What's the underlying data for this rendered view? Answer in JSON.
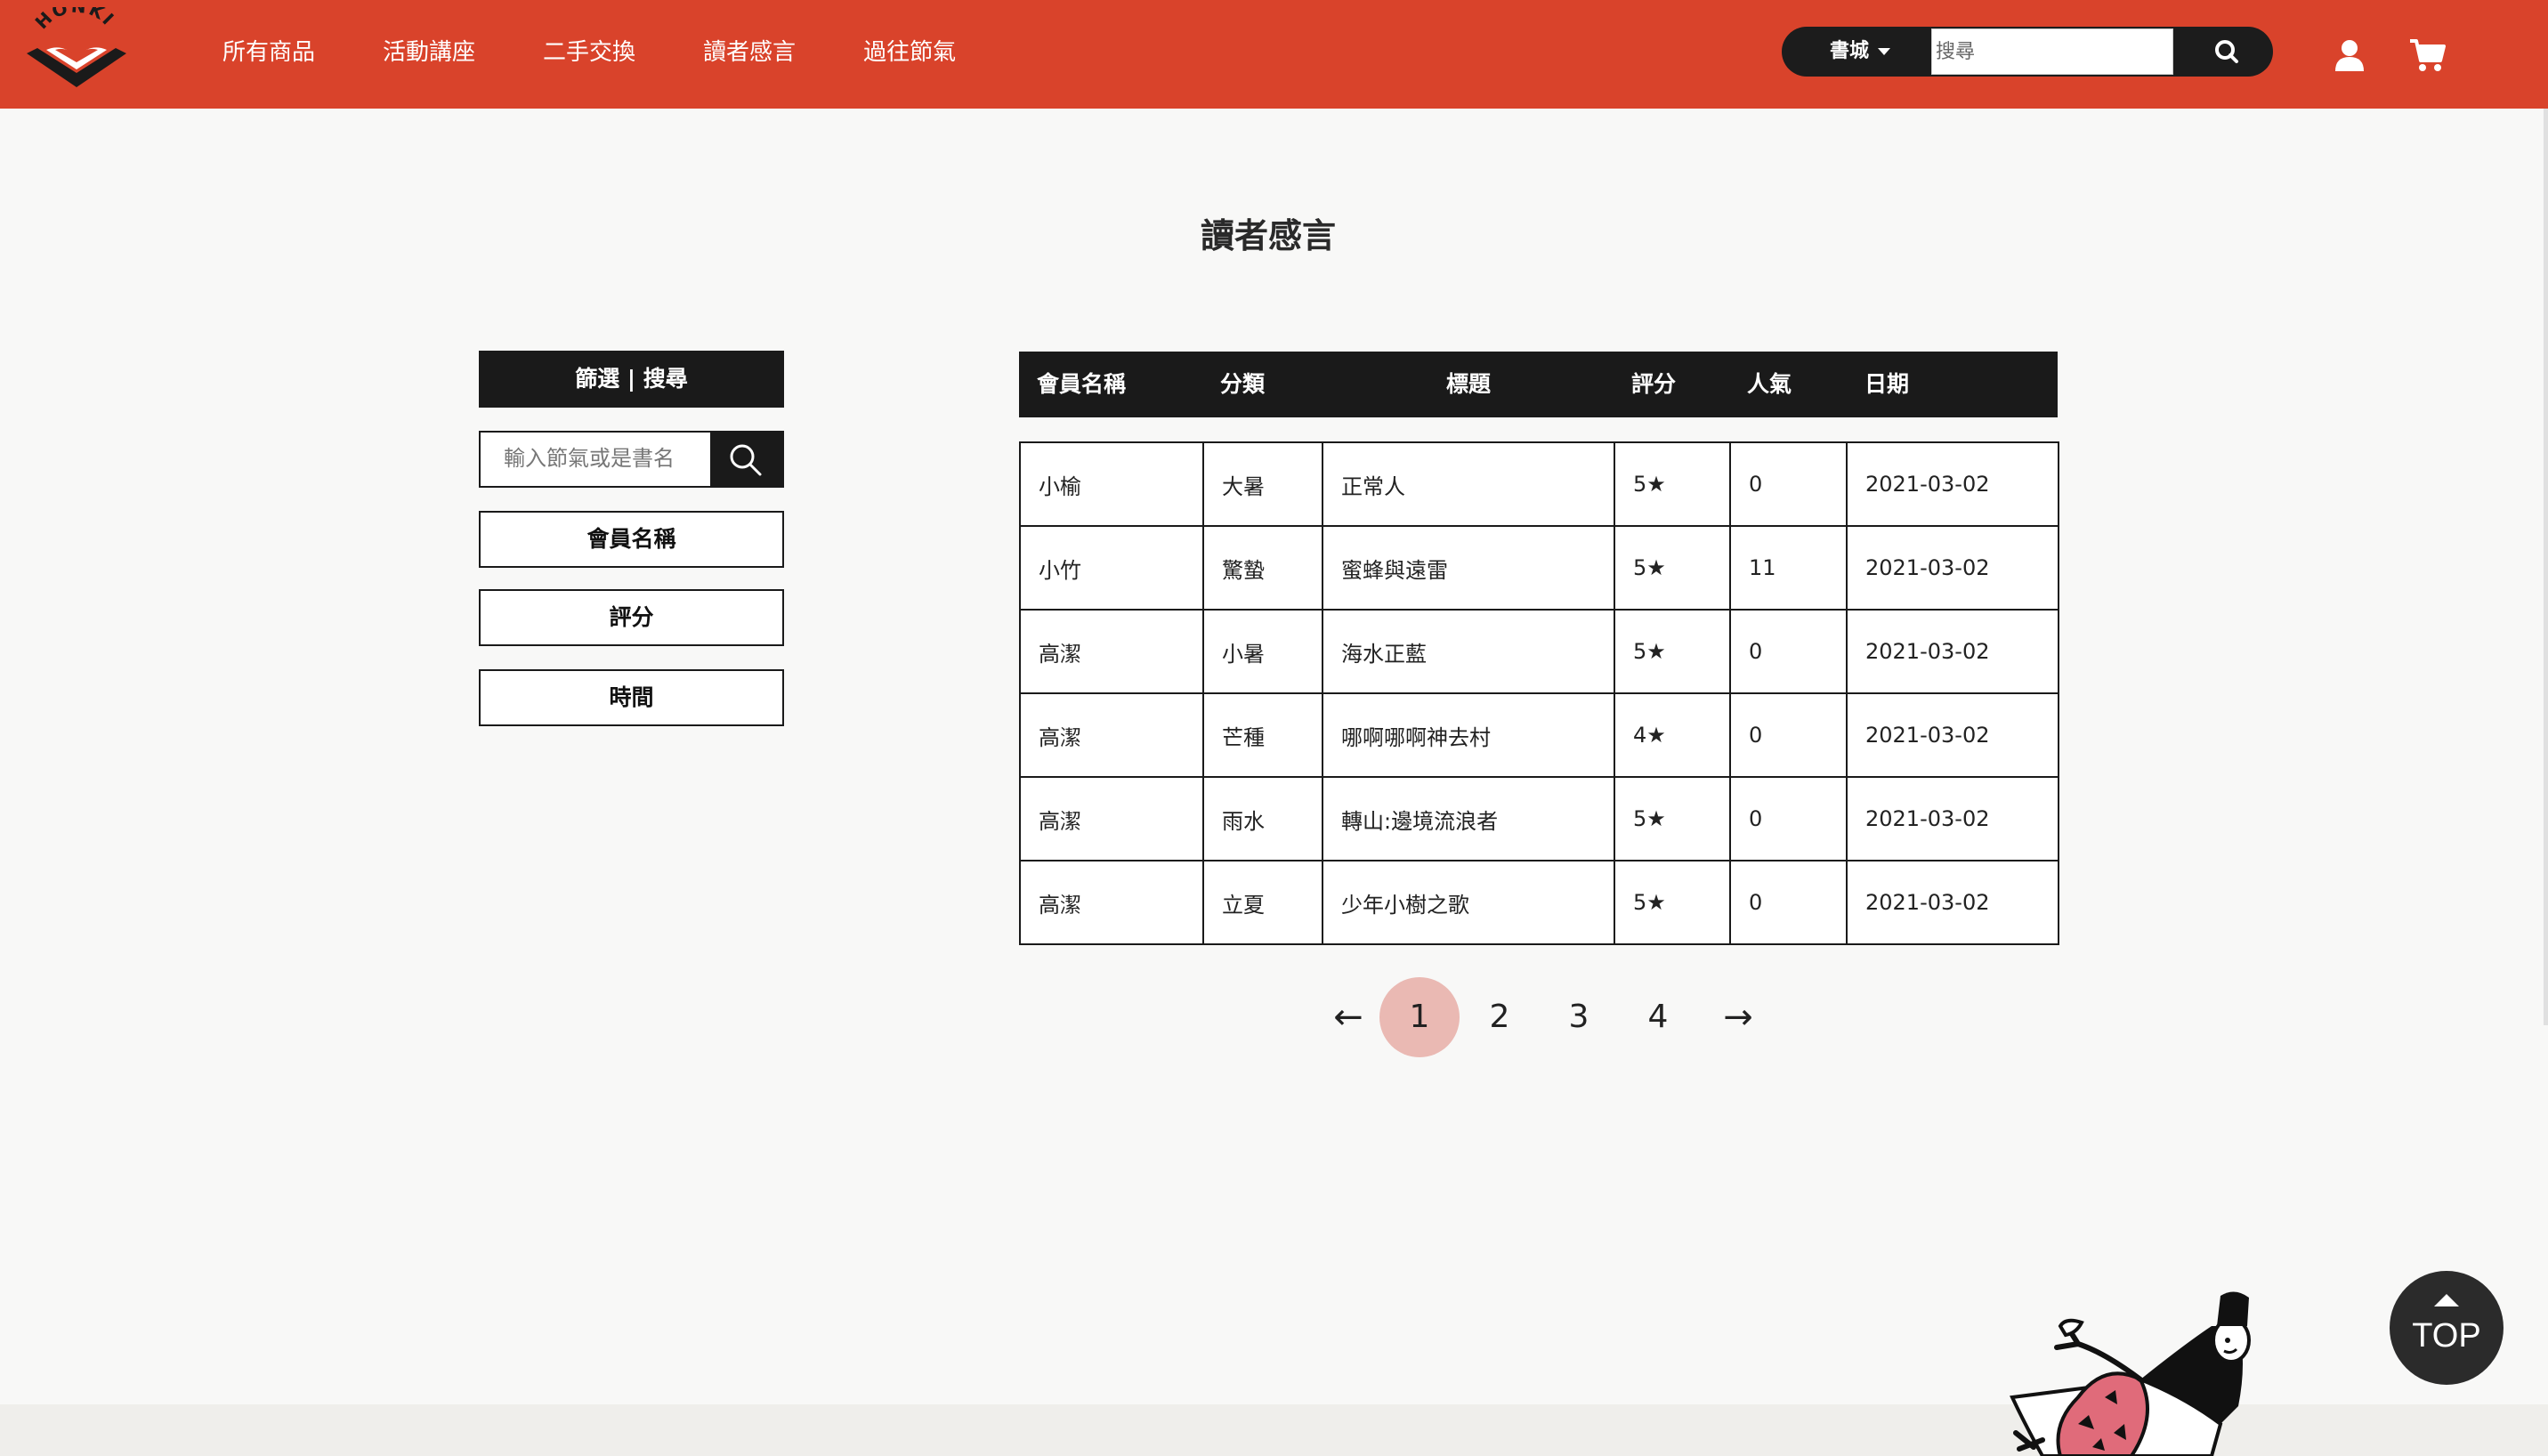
{
  "brand": {
    "logo_text": "HONKI",
    "accent": "#d9432b"
  },
  "nav": {
    "items": [
      "所有商品",
      "活動講座",
      "二手交換",
      "讀者感言",
      "過往節氣"
    ]
  },
  "search": {
    "scope": "書城",
    "placeholder": "搜尋"
  },
  "page": {
    "title": "讀者感言"
  },
  "sidebar": {
    "header": "篩選 | 搜尋",
    "filter_placeholder": "輸入節氣或是書名",
    "sort_buttons": [
      "會員名稱",
      "評分",
      "時間"
    ]
  },
  "table": {
    "columns": [
      "會員名稱",
      "分類",
      "標題",
      "評分",
      "人氣",
      "日期"
    ],
    "rows": [
      [
        "小榆",
        "大暑",
        "正常人",
        "5★",
        "0",
        "2021-03-02"
      ],
      [
        "小竹",
        "驚蟄",
        "蜜蜂與遠雷",
        "5★",
        "11",
        "2021-03-02"
      ],
      [
        "高潔",
        "小暑",
        "海水正藍",
        "5★",
        "0",
        "2021-03-02"
      ],
      [
        "高潔",
        "芒種",
        "哪啊哪啊神去村",
        "4★",
        "0",
        "2021-03-02"
      ],
      [
        "高潔",
        "雨水",
        "轉山:邊境流浪者",
        "5★",
        "0",
        "2021-03-02"
      ],
      [
        "高潔",
        "立夏",
        "少年小樹之歌",
        "5★",
        "0",
        "2021-03-02"
      ]
    ]
  },
  "pagination": {
    "prev": "←",
    "pages": [
      "1",
      "2",
      "3",
      "4"
    ],
    "current": "1",
    "next": "→"
  },
  "top_button": {
    "label": "TOP"
  }
}
